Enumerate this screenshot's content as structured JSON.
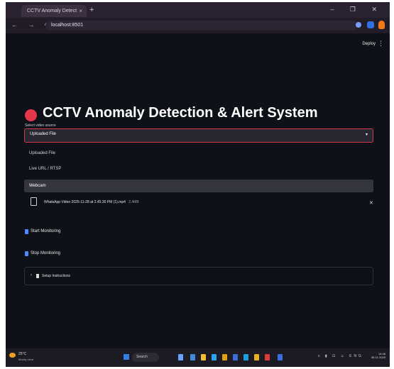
{
  "browser": {
    "tab_title": "CCTV Anomaly Detect",
    "tab_close": "×",
    "new_tab": "+",
    "url": "localhost:8501",
    "window_controls": "– ❐ ✕",
    "nav": "← → ⟳"
  },
  "app": {
    "deploy_label": "Deploy",
    "menu_icon": "⋮",
    "title": "CCTV Anomaly Detection & Alert System",
    "select_label": "Select video source",
    "selected_value": "Uploaded File",
    "chevron": "▾",
    "options": [
      "Uploaded File",
      "Live URL / RTSP",
      "Webcam"
    ],
    "file": {
      "name": "WhatsApp Video 2025-11-28 at 2.45.30 PM (1).mp4",
      "size": "2.4MB",
      "remove": "✕"
    },
    "start_button": "Start Monitoring",
    "stop_button": "Stop Monitoring",
    "expander_arrow": "›",
    "expander_label": "Setup Instructions"
  },
  "taskbar": {
    "temperature": "25°C",
    "condition": "Mostly clear",
    "search_placeholder": "Search",
    "tray": "ʌ ▮ ⊡ ☺ ENG",
    "time": "14:46",
    "date": "28-11-2025"
  },
  "colors": {
    "background": "#0e1117",
    "accent": "#e5364a",
    "button_icon": "#4a8cff"
  }
}
